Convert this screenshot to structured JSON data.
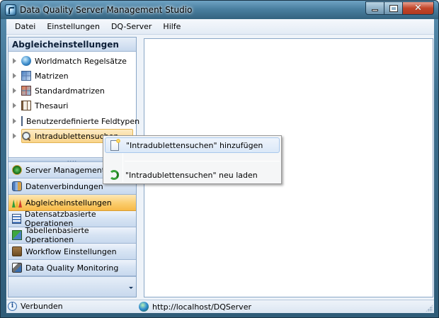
{
  "window": {
    "title": "Data Quality Server Management Studio"
  },
  "menu": {
    "items": [
      {
        "label": "Datei"
      },
      {
        "label": "Einstellungen"
      },
      {
        "label": "DQ-Server"
      },
      {
        "label": "Hilfe"
      }
    ]
  },
  "sidebar": {
    "header": "Abgleicheinstellungen",
    "tree": [
      {
        "label": "Worldmatch Regelsätze",
        "icon": "globe-icon"
      },
      {
        "label": "Matrizen",
        "icon": "matrix-icon"
      },
      {
        "label": "Standardmatrizen",
        "icon": "standard-matrix-icon"
      },
      {
        "label": "Thesauri",
        "icon": "book-icon"
      },
      {
        "label": "Benutzerdefinierte Feldtypen",
        "icon": "table-icon"
      },
      {
        "label": "Intradublettensuchen",
        "icon": "search-icon",
        "selected": true
      }
    ],
    "splitter_glyph": "....",
    "nav": [
      {
        "label": "Server Management",
        "icon": "server-icon"
      },
      {
        "label": "Datenverbindungen",
        "icon": "database-icon"
      },
      {
        "label": "Abgleicheinstellungen",
        "icon": "match-icon",
        "active": true
      },
      {
        "label": "Datensatzbasierte Operationen",
        "icon": "record-icon"
      },
      {
        "label": "Tabellenbasierte Operationen",
        "icon": "table-ops-icon"
      },
      {
        "label": "Workflow Einstellungen",
        "icon": "workflow-icon"
      },
      {
        "label": "Data Quality Monitoring",
        "icon": "monitoring-icon"
      }
    ]
  },
  "context_menu": {
    "items": [
      {
        "label": "\"Intradublettensuchen\" hinzufügen",
        "icon": "new-document-icon"
      },
      {
        "label": "\"Intradublettensuchen\" neu laden",
        "icon": "refresh-icon"
      }
    ]
  },
  "status": {
    "connection": "Verbunden",
    "server_url": "http://localhost/DQServer"
  },
  "colors": {
    "titlebar": "#4a7fa0",
    "active_nav": "#fbcf72",
    "selection": "#f9d489",
    "panel_border": "#8aa7c7"
  }
}
